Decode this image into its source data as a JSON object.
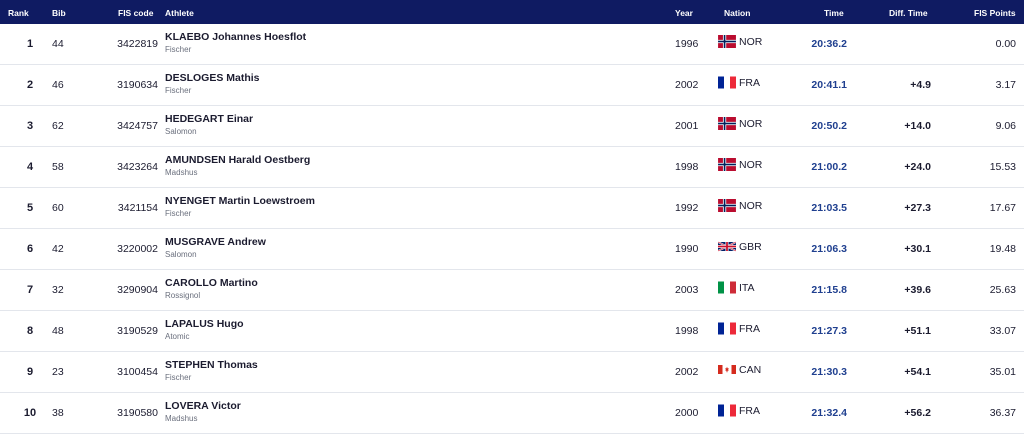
{
  "headers": {
    "rank": "Rank",
    "bib": "Bib",
    "fis_code": "FIS code",
    "athlete": "Athlete",
    "year": "Year",
    "nation": "Nation",
    "time": "Time",
    "diff_time": "Diff. Time",
    "fis_points": "FIS Points"
  },
  "rows": [
    {
      "rank": "1",
      "bib": "44",
      "fis_code": "3422819",
      "name": "KLAEBO Johannes Hoesflot",
      "ski": "Fischer",
      "year": "1996",
      "nation": "NOR",
      "flag": "nor",
      "time": "20:36.2",
      "diff": "",
      "points": "0.00"
    },
    {
      "rank": "2",
      "bib": "46",
      "fis_code": "3190634",
      "name": "DESLOGES Mathis",
      "ski": "Fischer",
      "year": "2002",
      "nation": "FRA",
      "flag": "fra",
      "time": "20:41.1",
      "diff": "+4.9",
      "points": "3.17"
    },
    {
      "rank": "3",
      "bib": "62",
      "fis_code": "3424757",
      "name": "HEDEGART Einar",
      "ski": "Salomon",
      "year": "2001",
      "nation": "NOR",
      "flag": "nor",
      "time": "20:50.2",
      "diff": "+14.0",
      "points": "9.06"
    },
    {
      "rank": "4",
      "bib": "58",
      "fis_code": "3423264",
      "name": "AMUNDSEN Harald Oestberg",
      "ski": "Madshus",
      "year": "1998",
      "nation": "NOR",
      "flag": "nor",
      "time": "21:00.2",
      "diff": "+24.0",
      "points": "15.53"
    },
    {
      "rank": "5",
      "bib": "60",
      "fis_code": "3421154",
      "name": "NYENGET Martin Loewstroem",
      "ski": "Fischer",
      "year": "1992",
      "nation": "NOR",
      "flag": "nor",
      "time": "21:03.5",
      "diff": "+27.3",
      "points": "17.67"
    },
    {
      "rank": "6",
      "bib": "42",
      "fis_code": "3220002",
      "name": "MUSGRAVE Andrew",
      "ski": "Salomon",
      "year": "1990",
      "nation": "GBR",
      "flag": "gbr",
      "time": "21:06.3",
      "diff": "+30.1",
      "points": "19.48"
    },
    {
      "rank": "7",
      "bib": "32",
      "fis_code": "3290904",
      "name": "CAROLLO Martino",
      "ski": "Rossignol",
      "year": "2003",
      "nation": "ITA",
      "flag": "ita",
      "time": "21:15.8",
      "diff": "+39.6",
      "points": "25.63"
    },
    {
      "rank": "8",
      "bib": "48",
      "fis_code": "3190529",
      "name": "LAPALUS Hugo",
      "ski": "Atomic",
      "year": "1998",
      "nation": "FRA",
      "flag": "fra",
      "time": "21:27.3",
      "diff": "+51.1",
      "points": "33.07"
    },
    {
      "rank": "9",
      "bib": "23",
      "fis_code": "3100454",
      "name": "STEPHEN Thomas",
      "ski": "Fischer",
      "year": "2002",
      "nation": "CAN",
      "flag": "can",
      "time": "21:30.3",
      "diff": "+54.1",
      "points": "35.01"
    },
    {
      "rank": "10",
      "bib": "38",
      "fis_code": "3190580",
      "name": "LOVERA Victor",
      "ski": "Madshus",
      "year": "2000",
      "nation": "FRA",
      "flag": "fra",
      "time": "21:32.4",
      "diff": "+56.2",
      "points": "36.37"
    }
  ],
  "colors": {
    "header_bg": "#0f1b62",
    "time_text": "#1f3f8f",
    "row_border": "#e3e6ec"
  }
}
